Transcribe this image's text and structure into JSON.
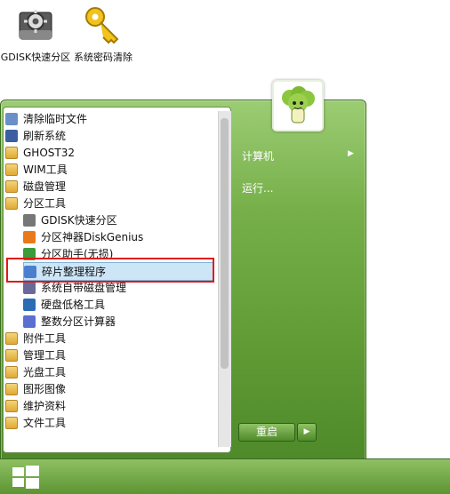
{
  "desktop": {
    "icons": [
      {
        "label": "GDISK快速分区",
        "icon": "gear-disk-icon"
      },
      {
        "label": "系统密码清除",
        "icon": "key-icon"
      }
    ]
  },
  "start_menu": {
    "programs": [
      {
        "label": "清除临时文件",
        "icon": "cleanup-icon"
      },
      {
        "label": "刷新系统",
        "icon": "monitor-icon"
      },
      {
        "label": "GHOST32",
        "icon": "folder-icon"
      },
      {
        "label": "WIM工具",
        "icon": "folder-icon"
      },
      {
        "label": "磁盘管理",
        "icon": "folder-icon"
      },
      {
        "label": "分区工具",
        "icon": "folder-icon"
      },
      {
        "label": "GDISK快速分区",
        "icon": "gear-disk-icon"
      },
      {
        "label": "分区神器DiskGenius",
        "icon": "diskgenius-icon"
      },
      {
        "label": "分区助手(无损)",
        "icon": "partition-assistant-icon"
      },
      {
        "label": "碎片整理程序",
        "icon": "defrag-icon",
        "selected": true
      },
      {
        "label": "系统自带磁盘管理",
        "icon": "disk-management-icon"
      },
      {
        "label": "硬盘低格工具",
        "icon": "lowformat-icon"
      },
      {
        "label": "整数分区计算器",
        "icon": "calculator-icon"
      },
      {
        "label": "附件工具",
        "icon": "folder-icon"
      },
      {
        "label": "管理工具",
        "icon": "folder-icon"
      },
      {
        "label": "光盘工具",
        "icon": "folder-icon"
      },
      {
        "label": "图形图像",
        "icon": "folder-icon"
      },
      {
        "label": "维护资料",
        "icon": "folder-icon"
      },
      {
        "label": "文件工具",
        "icon": "folder-icon"
      }
    ],
    "right": {
      "computer": "计算机",
      "run": "运行...",
      "restart": "重启"
    }
  },
  "colors": {
    "menu_green": "#6fa843",
    "highlight_red": "#e01818"
  }
}
